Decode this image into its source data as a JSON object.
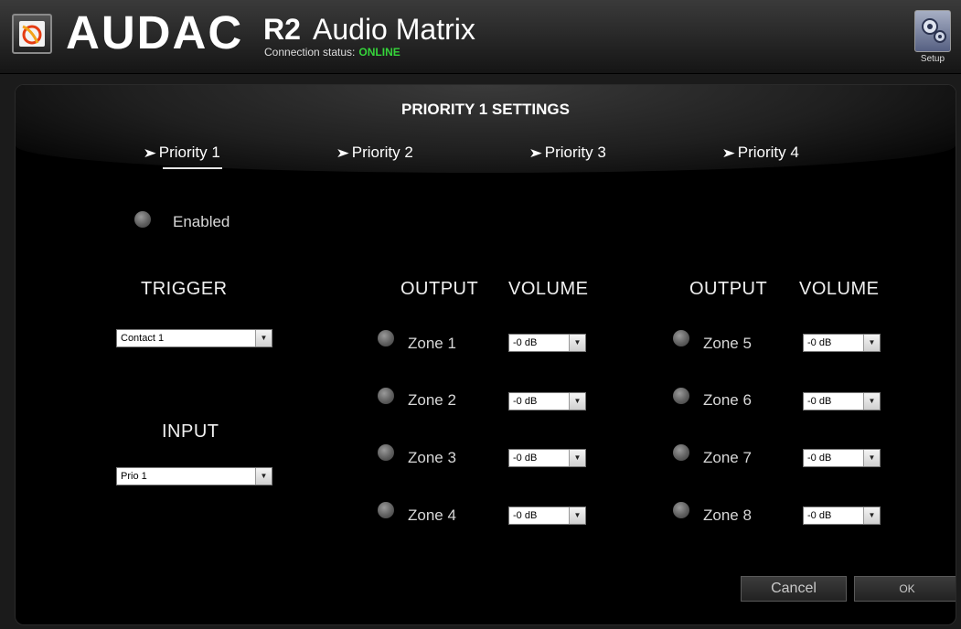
{
  "header": {
    "brand": "AUDAC",
    "product_model": "R2",
    "product_name": "Audio Matrix",
    "connection_label": "Connection status:",
    "connection_status": "ONLINE",
    "setup_label": "Setup"
  },
  "settings_title": "PRIORITY 1 SETTINGS",
  "tabs": [
    {
      "label": "Priority 1",
      "active": true
    },
    {
      "label": "Priority 2",
      "active": false
    },
    {
      "label": "Priority 3",
      "active": false
    },
    {
      "label": "Priority 4",
      "active": false
    }
  ],
  "enabled_label": "Enabled",
  "trigger": {
    "heading": "TRIGGER",
    "value": "Contact 1"
  },
  "input": {
    "heading": "INPUT",
    "value": "Prio 1"
  },
  "outputs_left": {
    "output_heading": "OUTPUT",
    "volume_heading": "VOLUME",
    "zones": [
      {
        "label": "Zone 1",
        "volume": "-0 dB"
      },
      {
        "label": "Zone 2",
        "volume": "-0 dB"
      },
      {
        "label": "Zone 3",
        "volume": "-0 dB"
      },
      {
        "label": "Zone 4",
        "volume": "-0 dB"
      }
    ]
  },
  "outputs_right": {
    "output_heading": "OUTPUT",
    "volume_heading": "VOLUME",
    "zones": [
      {
        "label": "Zone 5",
        "volume": "-0 dB"
      },
      {
        "label": "Zone 6",
        "volume": "-0 dB"
      },
      {
        "label": "Zone 7",
        "volume": "-0 dB"
      },
      {
        "label": "Zone 8",
        "volume": "-0 dB"
      }
    ]
  },
  "buttons": {
    "cancel": "Cancel",
    "ok": "OK"
  },
  "colors": {
    "online": "#35d43a",
    "background": "#000000"
  }
}
